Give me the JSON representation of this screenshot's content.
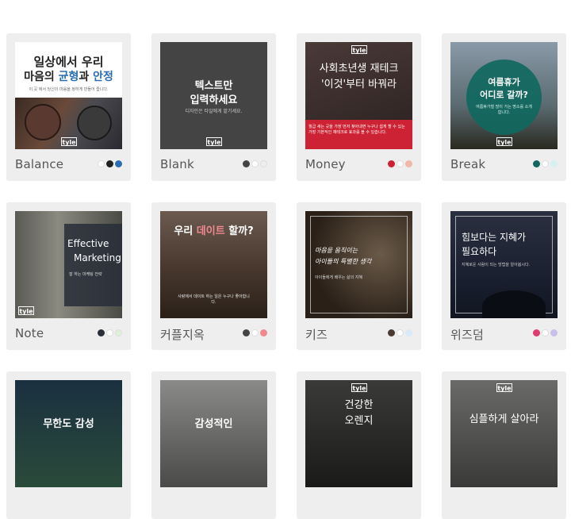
{
  "brand": "tyle",
  "cards": [
    {
      "name": "Balance",
      "thumb_title_1": "일상에서 우리",
      "thumb_title_2": "마음의",
      "thumb_title_3": "균형",
      "thumb_title_4": "과",
      "thumb_title_5": "안정",
      "thumb_sub": "이 곳 에서 당신이 마음을 정하게 만들어 줍니다.",
      "dots": [
        "#ffffff",
        "#222222",
        "#2a6db0"
      ]
    },
    {
      "name": "Blank",
      "thumb_title_1": "텍스트만",
      "thumb_title_2": "입력하세요",
      "thumb_sub": "디자인은 타일에게 맡기세요.",
      "dots": [
        "#444444",
        "#ffffff",
        "#eeeeee"
      ]
    },
    {
      "name": "Money",
      "thumb_title_1": "사회초년생 재테크",
      "thumb_title_2": "'이것'부터 바꿔라",
      "thumb_sub": "월급 새는 곳을 가장 먼저 찾아내면 누구나 쉽게 할 수 있는 가장 기본적인 재테크로 효과를 볼 수 있습니다.",
      "dots": [
        "#cc2233",
        "#ffffff",
        "#f0b8a8"
      ]
    },
    {
      "name": "Break",
      "thumb_title_1": "여름휴가",
      "thumb_title_2": "어디로 갈까?",
      "thumb_sub": "여름휴가철 많이 가는 명소를 소개합니다.",
      "dots": [
        "#10685e",
        "#ffffff",
        "#d8f0f0"
      ]
    },
    {
      "name": "Note",
      "thumb_title_1": "Effective",
      "thumb_title_2": "Marketing",
      "thumb_sub": "잘 하는 마케팅 전략",
      "dots": [
        "#2a2f38",
        "#ffffff",
        "#dff0d8"
      ]
    },
    {
      "name": "커플지옥",
      "thumb_title_1": "우리",
      "thumb_title_2": "데이트",
      "thumb_title_3": "할까?",
      "thumb_sub": "사랑에서 데이트 하는 일은 누구나 좋아합니다.",
      "dots": [
        "#444444",
        "#ffffff",
        "#f08890"
      ]
    },
    {
      "name": "키즈",
      "thumb_title_1": "마음을 움직이는",
      "thumb_title_2": "아이들의 특별한 생각",
      "thumb_sub": "아이들에게 배우는 삶의 지혜",
      "dots": [
        "#4a3a30",
        "#ffffff",
        "#d8eaf8"
      ]
    },
    {
      "name": "위즈덤",
      "thumb_title_1": "힘보다는 지혜가",
      "thumb_title_2": "필요하다",
      "thumb_sub": "지혜로운 사람이 되는 방법을 알아봅시다.",
      "dots": [
        "#e03a70",
        "#ffffff",
        "#c8c0e8"
      ]
    },
    {
      "name": "",
      "thumb_title_1": "무한도 감성",
      "dots": []
    },
    {
      "name": "",
      "thumb_title_1": "감성적인",
      "dots": []
    },
    {
      "name": "",
      "thumb_title_1": "건강한",
      "thumb_title_2": "오렌지",
      "dots": []
    },
    {
      "name": "",
      "thumb_title_1": "심플하게 살아라",
      "dots": []
    }
  ]
}
